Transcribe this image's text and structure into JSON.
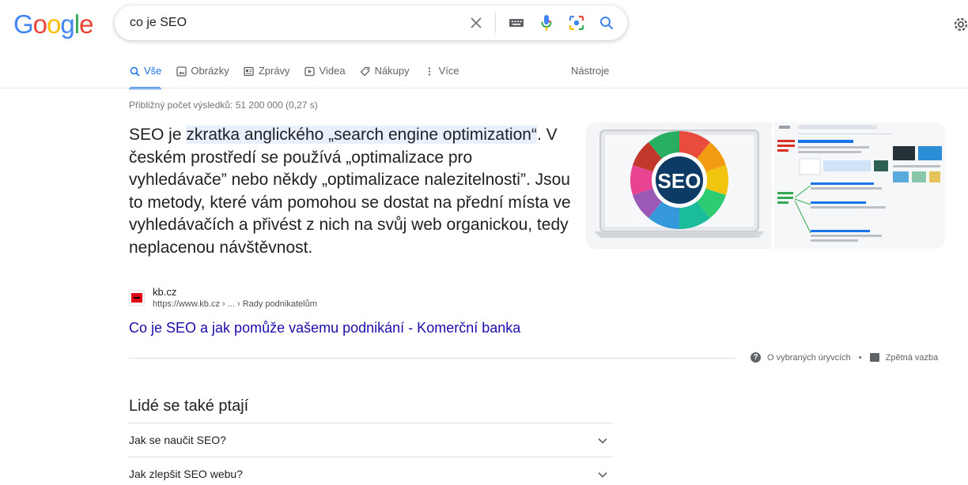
{
  "header": {
    "logo_letters": [
      "G",
      "o",
      "o",
      "g",
      "l",
      "e"
    ],
    "query": "co je SEO"
  },
  "tabs": [
    {
      "label": "Vše",
      "icon": "search-icon",
      "active": true
    },
    {
      "label": "Obrázky",
      "icon": "image-icon",
      "active": false
    },
    {
      "label": "Zprávy",
      "icon": "news-icon",
      "active": false
    },
    {
      "label": "Videa",
      "icon": "play-icon",
      "active": false
    },
    {
      "label": "Nákupy",
      "icon": "tag-icon",
      "active": false
    },
    {
      "label": "Více",
      "icon": "more-vert-icon",
      "active": false
    }
  ],
  "tools_label": "Nástroje",
  "result_stats": "Přibližný počet výsledků: 51 200 000 (0,27 s)",
  "snippet": {
    "pre": "SEO je ",
    "highlight": "zkratka anglického „search engine optimization“",
    "post": ". V českém prostředí se používá „optimalizace pro vyhledávače” nebo někdy „optimalizace nalezitelnosti”. Jsou to metody, které vám pomohou se dostat na přední místa ve vyhledávačích a přivést z nich na svůj web organickou, tedy neplacenou návštěvnost."
  },
  "image_left_text": "SEO",
  "source": {
    "name": "kb.cz",
    "url": "https://www.kb.cz › ... › Rady podnikatelům"
  },
  "result_title": "Co je SEO a jak pomůže vašemu podnikání - Komerční banka",
  "feedback": {
    "about": "O vybraných úryvcích",
    "separator": "•",
    "feedback": "Zpětná vazba"
  },
  "paa": {
    "title": "Lidé se také ptají",
    "items": [
      "Jak se naučit SEO?",
      "Jak zlepšit SEO webu?"
    ]
  },
  "colors": {
    "accent": "#1a73e8",
    "link": "#1a0dab",
    "highlight": "#e8f0fe"
  }
}
